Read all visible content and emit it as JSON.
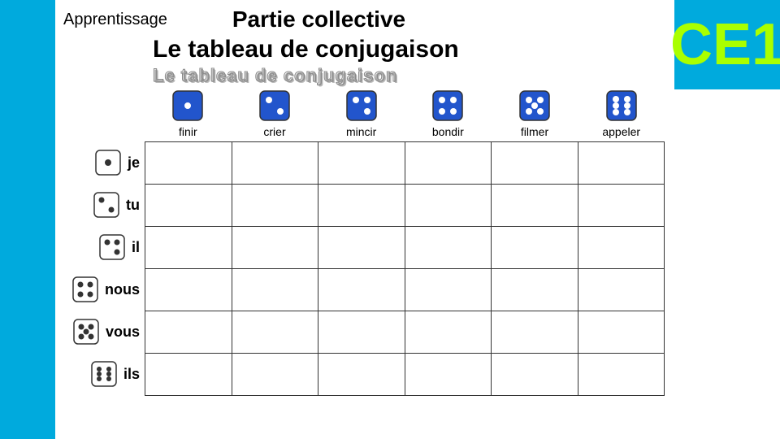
{
  "header": {
    "apprentissage": "Apprentissage",
    "partie_collective": "Partie collective",
    "main_title": "Le tableau de conjugaison",
    "deco_title": "Le tableau de conjugaison",
    "ce1": "CE1"
  },
  "verbs": [
    {
      "label": "finir",
      "dots": 1
    },
    {
      "label": "crier",
      "dots": 2
    },
    {
      "label": "mincir",
      "dots": 3
    },
    {
      "label": "bondir",
      "dots": 4
    },
    {
      "label": "filmer",
      "dots": 5
    },
    {
      "label": "appeler",
      "dots": 6
    }
  ],
  "pronouns": [
    {
      "label": "je",
      "dots": 1
    },
    {
      "label": "tu",
      "dots": 2
    },
    {
      "label": "il",
      "dots": 3
    },
    {
      "label": "nous",
      "dots": 4
    },
    {
      "label": "vous",
      "dots": 5
    },
    {
      "label": "ils",
      "dots": 6
    }
  ],
  "colors": {
    "blue_bar": "#00aadd",
    "green_text": "#aaff00",
    "die_blue": "#2255cc",
    "die_white": "#ffffff",
    "border": "#333333"
  }
}
